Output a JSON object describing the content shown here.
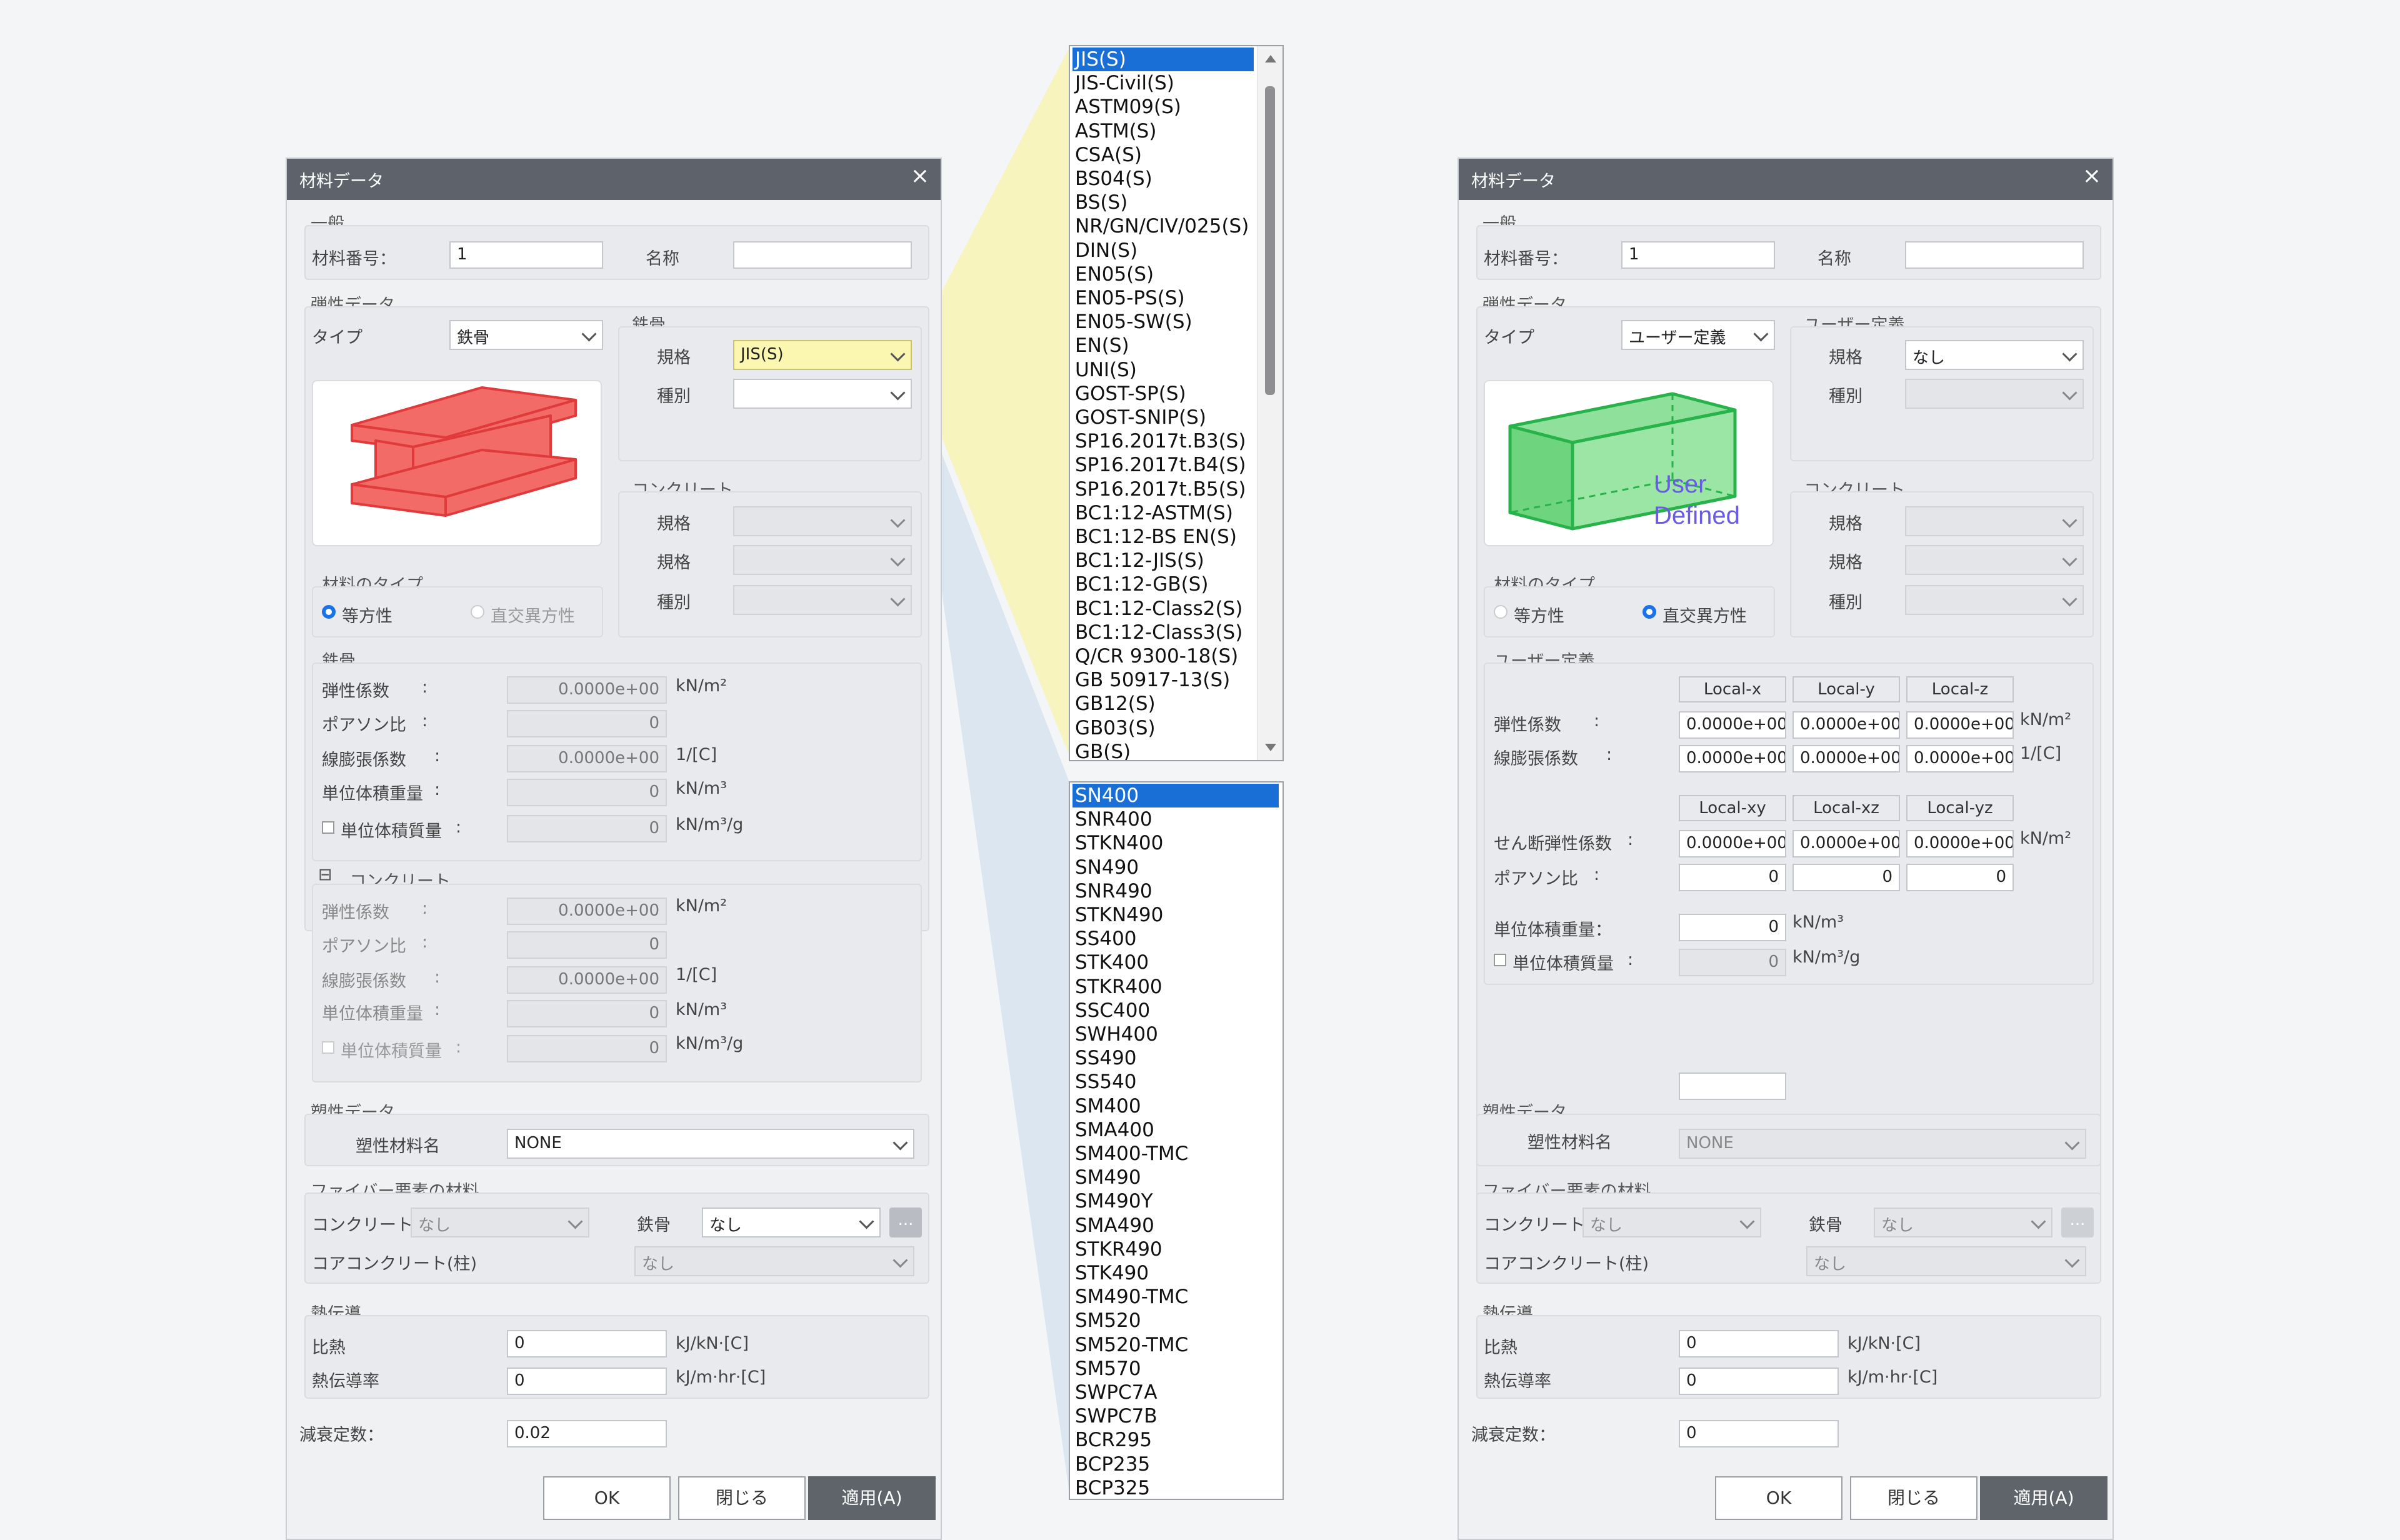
{
  "colors": {
    "accent": "#1a73e8",
    "titlebar": "#5e636b",
    "highlight": "#fbf7b0"
  },
  "left": {
    "title": "材料データ",
    "close": "×",
    "general": {
      "group": "一般",
      "num_label": "材料番号：",
      "num_value": "1",
      "name_label": "名称",
      "name_value": ""
    },
    "elastic": {
      "group": "弾性データ",
      "type_label": "タイプ",
      "type_value": "鉄骨"
    },
    "steel": {
      "group": "鉄骨",
      "std_label": "規格",
      "std_value": "JIS(S)",
      "kind_label": "種別",
      "kind_value": ""
    },
    "concrete": {
      "group": "コンクリート",
      "std1_label": "規格",
      "std2_label": "規格",
      "kind_label": "種別"
    },
    "mattype": {
      "group": "材料のタイプ",
      "iso": "等方性",
      "ortho": "直交異方性"
    },
    "steelprops": {
      "group": "鉄骨",
      "rows": [
        {
          "label": "弾性係数",
          "colon": ":",
          "value": "0.0000e+00",
          "unit": "kN/m²"
        },
        {
          "label": "ポアソン比",
          "colon": ":",
          "value": "0",
          "unit": ""
        },
        {
          "label": "線膨張係数",
          "colon": ":",
          "value": "0.0000e+00",
          "unit": "1/[C]"
        },
        {
          "label": "単位体積重量",
          "colon": ":",
          "value": "0",
          "unit": "kN/m³"
        },
        {
          "label": "単位体積質量",
          "colon": ":",
          "value": "0",
          "unit": "kN/m³/g"
        }
      ]
    },
    "concprops": {
      "group": "コンクリート",
      "collapse": "⊟",
      "rows": [
        {
          "label": "弾性係数",
          "colon": ":",
          "value": "0.0000e+00",
          "unit": "kN/m²"
        },
        {
          "label": "ポアソン比",
          "colon": ":",
          "value": "0",
          "unit": ""
        },
        {
          "label": "線膨張係数",
          "colon": ":",
          "value": "0.0000e+00",
          "unit": "1/[C]"
        },
        {
          "label": "単位体積重量",
          "colon": ":",
          "value": "0",
          "unit": "kN/m³"
        },
        {
          "label": "単位体積質量",
          "colon": ":",
          "value": "0",
          "unit": "kN/m³/g"
        }
      ]
    },
    "plastic": {
      "group": "塑性データ",
      "label": "塑性材料名",
      "value": "NONE"
    },
    "fiber": {
      "group": "ファイバー要素の材料",
      "conc_label": "コンクリート",
      "conc_value": "なし",
      "steel_label": "鉄骨",
      "steel_value": "なし",
      "ellipsis": "...",
      "core_label": "コアコンクリート(柱)",
      "core_value": "なし"
    },
    "heat": {
      "group": "熱伝導",
      "sh_label": "比熱",
      "sh_value": "0",
      "sh_unit": "kJ/kN·[C]",
      "tc_label": "熱伝導率",
      "tc_value": "0",
      "tc_unit": "kJ/m·hr·[C]"
    },
    "damping": {
      "label": "減衰定数：",
      "value": "0.02"
    },
    "buttons": {
      "ok": "OK",
      "close": "閉じる",
      "apply": "適用(A)"
    }
  },
  "right": {
    "title": "材料データ",
    "close": "×",
    "general": {
      "group": "一般",
      "num_label": "材料番号：",
      "num_value": "1",
      "name_label": "名称",
      "name_value": ""
    },
    "elastic": {
      "group": "弾性データ",
      "type_label": "タイプ",
      "type_value": "ユーザー定義"
    },
    "user": {
      "group": "ユーザー定義",
      "std_label": "規格",
      "std_value": "なし",
      "kind_label": "種別"
    },
    "concrete": {
      "group": "コンクリート",
      "std1_label": "規格",
      "std2_label": "規格",
      "kind_label": "種別"
    },
    "cube_text": [
      "User",
      "Defined"
    ],
    "mattype": {
      "group": "材料のタイプ",
      "iso": "等方性",
      "ortho": "直交異方性"
    },
    "userdef": {
      "group": "ユーザー定義",
      "hdr1": [
        "Local-x",
        "Local-y",
        "Local-z"
      ],
      "hdr2": [
        "Local-xy",
        "Local-xz",
        "Local-yz"
      ],
      "e_label": "弾性係数",
      "e_vals": [
        "0.0000e+00",
        "0.0000e+00",
        "0.0000e+00"
      ],
      "e_unit": "kN/m²",
      "a_label": "線膨張係数",
      "a_vals": [
        "0.0000e+00",
        "0.0000e+00",
        "0.0000e+00"
      ],
      "a_unit": "1/[C]",
      "g_label": "せん断弾性係数",
      "g_vals": [
        "0.0000e+00",
        "0.0000e+00",
        "0.0000e+00"
      ],
      "g_unit": "kN/m²",
      "p_label": "ポアソン比",
      "p_vals": [
        "0",
        "0",
        "0"
      ],
      "w_label": "単位体積重量：",
      "w_value": "0",
      "w_unit": "kN/m³",
      "m_label": "単位体積質量",
      "m_value": "0",
      "m_unit": "kN/m³/g",
      "colon": ":"
    },
    "plastic": {
      "group": "塑性データ",
      "label": "塑性材料名",
      "value": "NONE"
    },
    "fiber": {
      "group": "ファイバー要素の材料",
      "conc_label": "コンクリート",
      "conc_value": "なし",
      "steel_label": "鉄骨",
      "steel_value": "なし",
      "ellipsis": "...",
      "core_label": "コアコンクリート(柱)",
      "core_value": "なし"
    },
    "heat": {
      "group": "熱伝導",
      "sh_label": "比熱",
      "sh_value": "0",
      "sh_unit": "kJ/kN·[C]",
      "tc_label": "熱伝導率",
      "tc_value": "0",
      "tc_unit": "kJ/m·hr·[C]"
    },
    "damping": {
      "label": "減衰定数：",
      "value": "0"
    },
    "buttons": {
      "ok": "OK",
      "close": "閉じる",
      "apply": "適用(A)"
    }
  },
  "standards_list": [
    "JIS(S)",
    "JIS-Civil(S)",
    "ASTM09(S)",
    "ASTM(S)",
    "CSA(S)",
    "BS04(S)",
    "BS(S)",
    "NR/GN/CIV/025(S)",
    "DIN(S)",
    "EN05(S)",
    "EN05-PS(S)",
    "EN05-SW(S)",
    "EN(S)",
    "UNI(S)",
    "GOST-SP(S)",
    "GOST-SNIP(S)",
    "SP16.2017t.B3(S)",
    "SP16.2017t.B4(S)",
    "SP16.2017t.B5(S)",
    "BC1:12-ASTM(S)",
    "BC1:12-BS EN(S)",
    "BC1:12-JIS(S)",
    "BC1:12-GB(S)",
    "BC1:12-Class2(S)",
    "BC1:12-Class3(S)",
    "Q/CR 9300-18(S)",
    "GB 50917-13(S)",
    "GB12(S)",
    "GB03(S)",
    "GB(S)"
  ],
  "grades_list": [
    "SN400",
    "SNR400",
    "STKN400",
    "SN490",
    "SNR490",
    "STKN490",
    "SS400",
    "STK400",
    "STKR400",
    "SSC400",
    "SWH400",
    "SS490",
    "SS540",
    "SM400",
    "SMA400",
    "SM400-TMC",
    "SM490",
    "SM490Y",
    "SMA490",
    "STKR490",
    "STK490",
    "SM490-TMC",
    "SM520",
    "SM520-TMC",
    "SM570",
    "SWPC7A",
    "SWPC7B",
    "BCR295",
    "BCP235",
    "BCP325"
  ]
}
